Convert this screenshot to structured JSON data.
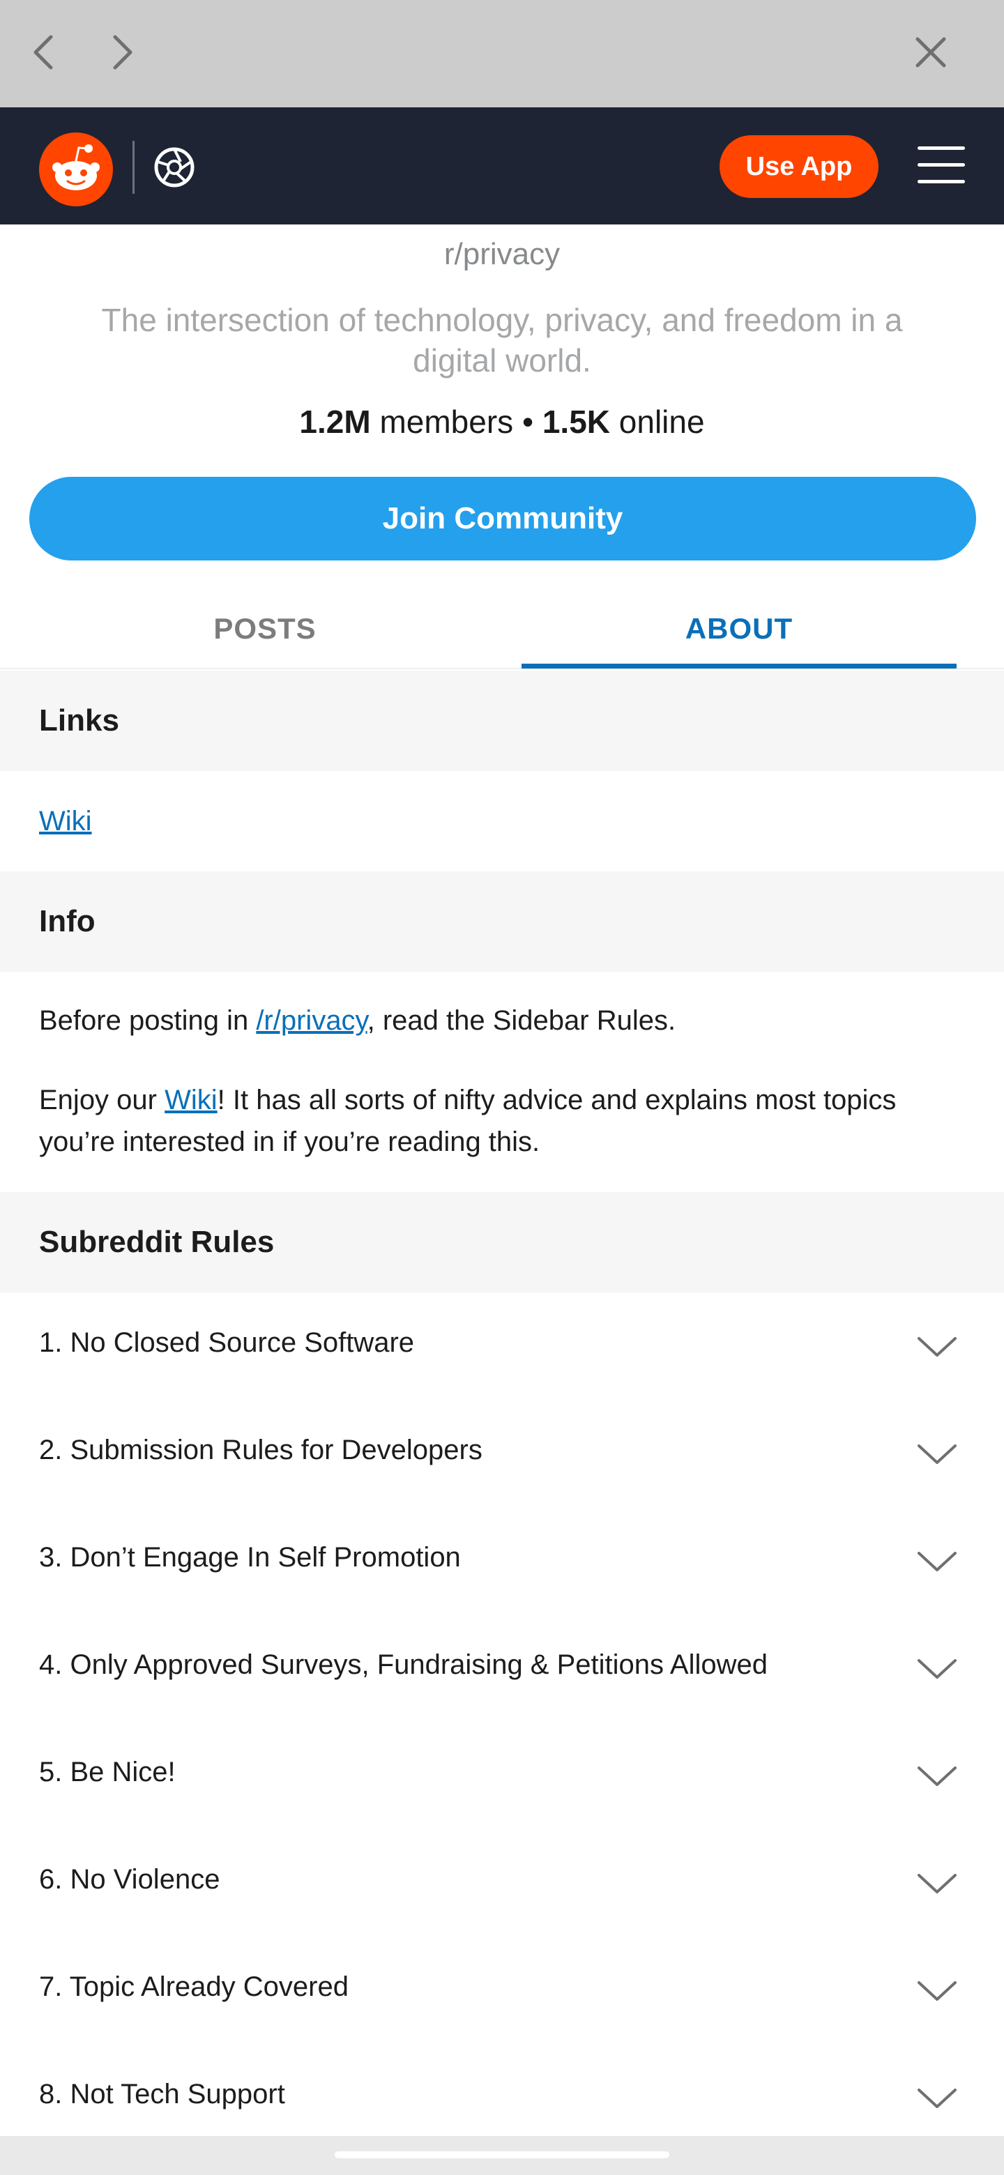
{
  "community": {
    "name": "r/privacy",
    "description": "The intersection of technology, privacy, and freedom in a digital world.",
    "members_count": "1.2M",
    "members_label": "members",
    "separator": "•",
    "online_count": "1.5K",
    "online_label": "online",
    "join_label": "Join Community"
  },
  "header": {
    "use_app_label": "Use App"
  },
  "tabs": [
    {
      "label": "POSTS",
      "active": false
    },
    {
      "label": "ABOUT",
      "active": true
    }
  ],
  "links": {
    "heading": "Links",
    "wiki_label": "Wiki"
  },
  "info": {
    "heading": "Info",
    "p1_before": "Before posting in ",
    "p1_link": "/r/privacy",
    "p1_after": ", read the Sidebar Rules.",
    "p2_before": "Enjoy our ",
    "p2_link": "Wiki",
    "p2_after": "! It has all sorts of nifty advice and explains most topics you’re interested in if you’re reading this."
  },
  "rules": {
    "heading": "Subreddit Rules",
    "items": [
      "1. No Closed Source Software",
      "2. Submission Rules for Developers",
      "3. Don’t Engage In Self Promotion",
      "4. Only Approved Surveys, Fundraising & Petitions Allowed",
      "5. Be Nice!",
      "6. No Violence",
      "7. Topic Already Covered",
      "8. Not Tech Support"
    ]
  },
  "colors": {
    "reddit_orange": "#ff4500",
    "header_bg": "#1e2433",
    "join_blue": "#24a0ed",
    "link_blue": "#0b6fb8"
  },
  "icons": [
    "chevron-left-icon",
    "chevron-right-icon",
    "close-icon",
    "reddit-snoo-icon",
    "aperture-icon",
    "hamburger-menu-icon",
    "chevron-down-icon"
  ]
}
